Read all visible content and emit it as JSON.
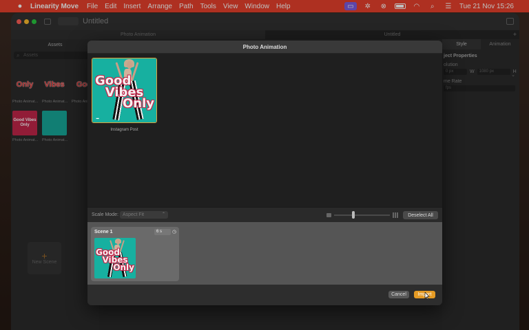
{
  "menubar": {
    "app_name": "Linearity Move",
    "menus": [
      "File",
      "Edit",
      "Insert",
      "Arrange",
      "Path",
      "Tools",
      "View",
      "Window",
      "Help"
    ],
    "clock": "Tue 21 Nov  15:26",
    "accent_color": "#e8412c"
  },
  "window": {
    "title": "Untitled",
    "tabs": [
      "Photo Animation",
      "Untitled"
    ]
  },
  "left_panel": {
    "header": "Assets",
    "search_placeholder": "Assets",
    "assets": [
      {
        "label": "Photo Animat...",
        "thumb_text": "Only",
        "kind": "text"
      },
      {
        "label": "Photo Animat...",
        "thumb_text": "Vibes",
        "kind": "text"
      },
      {
        "label": "Photo Animat...",
        "thumb_text": "Goo",
        "kind": "text"
      },
      {
        "label": "Photo Animat...",
        "thumb_text": "Good Vibes Only",
        "kind": "pink"
      },
      {
        "label": "Photo Animat...",
        "thumb_text": "",
        "kind": "teal"
      }
    ],
    "new_scene_label": "New Scene"
  },
  "right_panel": {
    "tabs": [
      "Style",
      "Animation"
    ],
    "section_title": "ject Properties",
    "resolution_label": "olution",
    "width_value": "0 px",
    "w_label": "W",
    "height_value": "1080 px",
    "h_label": "H",
    "frame_rate_label": "me Rate",
    "frame_rate_value": "fps"
  },
  "dialog": {
    "title": "Photo Animation",
    "media": [
      {
        "caption": "Instagram Post",
        "cover_lines": [
          "Good",
          "Vibes",
          "Only"
        ],
        "selected": true
      }
    ],
    "scale_mode_label": "Scale Mode:",
    "scale_mode_value": "Aspect Fit",
    "deselect_label": "Deselect All",
    "zoom_level": 0.35,
    "scenes": [
      {
        "name": "Scene 1",
        "duration": "6 s"
      }
    ],
    "cancel_label": "Cancel",
    "import_label": "Import",
    "accent_color": "#e59b24"
  }
}
